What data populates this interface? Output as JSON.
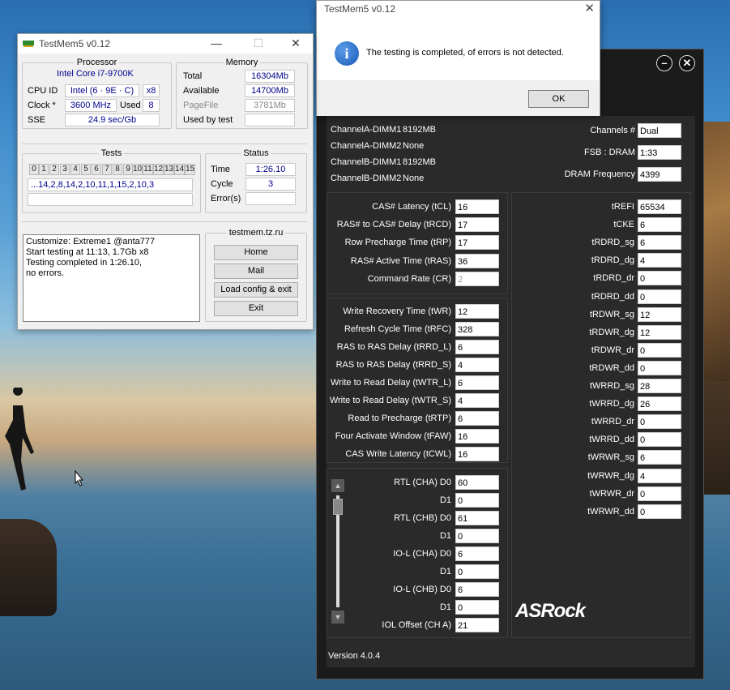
{
  "testmem": {
    "title": "TestMem5 v0.12",
    "processor": {
      "legend": "Processor",
      "model": "Intel Core i7-9700K",
      "cpu_id_label": "CPU ID",
      "cpu_id": "Intel  (6 · 9E · C)",
      "cpu_threads": "x8",
      "clock_label": "Clock *",
      "clock": "3600 MHz",
      "used_label": "Used",
      "used": "8",
      "sse_label": "SSE",
      "sse": "24.9 sec/Gb"
    },
    "memory": {
      "legend": "Memory",
      "total_label": "Total",
      "total": "16304Mb",
      "available_label": "Available",
      "available": "14700Mb",
      "pagefile_label": "PageFile",
      "pagefile": "3781Mb",
      "usedby_label": "Used by test",
      "usedby": ""
    },
    "tests": {
      "legend": "Tests",
      "cells": [
        "0",
        "1",
        "2",
        "3",
        "4",
        "5",
        "6",
        "7",
        "8",
        "9",
        "10",
        "11",
        "12",
        "13",
        "14",
        "15"
      ],
      "sequence": "...14,2,8,14,2,10,11,1,15,2,10,3"
    },
    "status": {
      "legend": "Status",
      "time_label": "Time",
      "time": "1:26.10",
      "cycle_label": "Cycle",
      "cycle": "3",
      "errors_label": "Error(s)",
      "errors": ""
    },
    "log": "Customize: Extreme1 @anta777\nStart testing at 11:13, 1.7Gb x8\nTesting completed in 1:26.10,\nno errors.",
    "site": {
      "legend": "testmem.tz.ru",
      "buttons": [
        "Home",
        "Mail",
        "Load config & exit",
        "Exit"
      ]
    }
  },
  "dialog": {
    "title": "TestMem5 v0.12",
    "close": "✕",
    "icon": "i",
    "message": "The testing is completed, of errors is not detected.",
    "ok": "OK"
  },
  "asrock": {
    "min": "–",
    "close": "✕",
    "dimms": [
      {
        "name": "ChannelA-DIMM1",
        "size": "8192MB"
      },
      {
        "name": "ChannelA-DIMM2",
        "size": "None"
      },
      {
        "name": "ChannelB-DIMM1",
        "size": "8192MB"
      },
      {
        "name": "ChannelB-DIMM2",
        "size": "None"
      }
    ],
    "info": [
      {
        "label": "Channels #",
        "value": "Dual"
      },
      {
        "label": "FSB : DRAM",
        "value": "1:33"
      },
      {
        "label": "DRAM Frequency",
        "value": "4399"
      }
    ],
    "primary": [
      {
        "label": "CAS# Latency (tCL)",
        "value": "16"
      },
      {
        "label": "RAS# to CAS# Delay (tRCD)",
        "value": "17"
      },
      {
        "label": "Row Precharge Time (tRP)",
        "value": "17"
      },
      {
        "label": "RAS# Active Time (tRAS)",
        "value": "36"
      },
      {
        "label": "Command Rate (CR)",
        "value": "2"
      }
    ],
    "secondary": [
      {
        "label": "Write Recovery Time (tWR)",
        "value": "12"
      },
      {
        "label": "Refresh Cycle Time (tRFC)",
        "value": "328"
      },
      {
        "label": "RAS to RAS Delay (tRRD_L)",
        "value": "6"
      },
      {
        "label": "RAS to RAS Delay (tRRD_S)",
        "value": "4"
      },
      {
        "label": "Write to Read Delay (tWTR_L)",
        "value": "6"
      },
      {
        "label": "Write to Read Delay (tWTR_S)",
        "value": "4"
      },
      {
        "label": "Read to Precharge (tRTP)",
        "value": "6"
      },
      {
        "label": "Four Activate Window (tFAW)",
        "value": "16"
      },
      {
        "label": "CAS Write Latency (tCWL)",
        "value": "16"
      }
    ],
    "rtl": [
      {
        "label": "RTL (CHA) D0",
        "value": "60"
      },
      {
        "label": "D1",
        "value": "0"
      },
      {
        "label": "RTL (CHB) D0",
        "value": "61"
      },
      {
        "label": "D1",
        "value": "0"
      },
      {
        "label": "IO-L (CHA) D0",
        "value": "6"
      },
      {
        "label": "D1",
        "value": "0"
      },
      {
        "label": "IO-L (CHB) D0",
        "value": "6"
      },
      {
        "label": "D1",
        "value": "0"
      },
      {
        "label": "IOL Offset (CH A)",
        "value": "21"
      }
    ],
    "tertiary": [
      {
        "label": "tREFI",
        "value": "65534"
      },
      {
        "label": "tCKE",
        "value": "6"
      },
      {
        "label": "tRDRD_sg",
        "value": "6"
      },
      {
        "label": "tRDRD_dg",
        "value": "4"
      },
      {
        "label": "tRDRD_dr",
        "value": "0"
      },
      {
        "label": "tRDRD_dd",
        "value": "0"
      },
      {
        "label": "tRDWR_sg",
        "value": "12"
      },
      {
        "label": "tRDWR_dg",
        "value": "12"
      },
      {
        "label": "tRDWR_dr",
        "value": "0"
      },
      {
        "label": "tRDWR_dd",
        "value": "0"
      },
      {
        "label": "tWRRD_sg",
        "value": "28"
      },
      {
        "label": "tWRRD_dg",
        "value": "26"
      },
      {
        "label": "tWRRD_dr",
        "value": "0"
      },
      {
        "label": "tWRRD_dd",
        "value": "0"
      },
      {
        "label": "tWRWR_sg",
        "value": "6"
      },
      {
        "label": "tWRWR_dg",
        "value": "4"
      },
      {
        "label": "tWRWR_dr",
        "value": "0"
      },
      {
        "label": "tWRWR_dd",
        "value": "0"
      }
    ],
    "logo": "ASRock",
    "version": "Version 4.0.4"
  }
}
